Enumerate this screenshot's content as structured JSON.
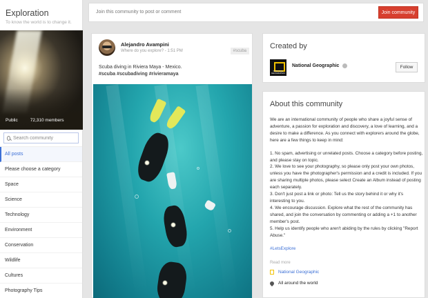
{
  "community": {
    "name": "Exploration",
    "tagline": "To know the world is to change it.",
    "visibility": "Public",
    "members": "72,310 members"
  },
  "search": {
    "placeholder": "Search community"
  },
  "categories": [
    "All posts",
    "Please choose a category",
    "Space",
    "Science",
    "Technology",
    "Environment",
    "Conservation",
    "Wildlife",
    "Cultures",
    "Photography Tips"
  ],
  "joinbar": {
    "prompt": "Join this community to post or comment",
    "button": "Join community"
  },
  "post": {
    "author": "Alejandro Avampini",
    "meta": "Where do you explore?  -  1:51 PM",
    "category_tag": "#scuba",
    "text": "Scuba diving in Riviera Maya - Mexico.",
    "hashtags": "#scuba  #scubadiving  #rivieramaya"
  },
  "created_by": {
    "title": "Created by",
    "name": "National Geographic",
    "logo_text": "NATIONAL GEOGRAPHIC",
    "follow": "Follow"
  },
  "about": {
    "title": "About this community",
    "intro": "We are an international community of people who share a joyful sense of adventure, a passion for exploration and discovery, a love of learning, and a desire to make a difference. As you connect with explorers around the globe, here are a few things to keep in mind:",
    "rules": [
      "1. No spam, advertising or unrelated posts. Choose a category before posting, and please stay on topic.",
      "2. We love to see your photography, so please only post your own photos, unless you have the photographer's permission and a credit is included. If you are sharing multiple photos, please select Create an Album instead of posting each separately.",
      "3. Don't just post a link or photo: Tell us the story behind it or why it's interesting to you.",
      "4. We encourage discussion. Explore what the rest of the community has shared, and join the conversation by commenting or adding a +1 to another member's post.",
      "5. Help us identify people who aren't abiding by the rules by clicking \"Report Abuse.\""
    ],
    "hashtag": "#LetsExplore",
    "read_more": "Read more",
    "link_ng": "National Geographic",
    "location": "All around the world"
  },
  "colors": {
    "accent_red": "#d73f2e",
    "link_blue": "#3b6fd6",
    "background": "#e5e5e5"
  }
}
